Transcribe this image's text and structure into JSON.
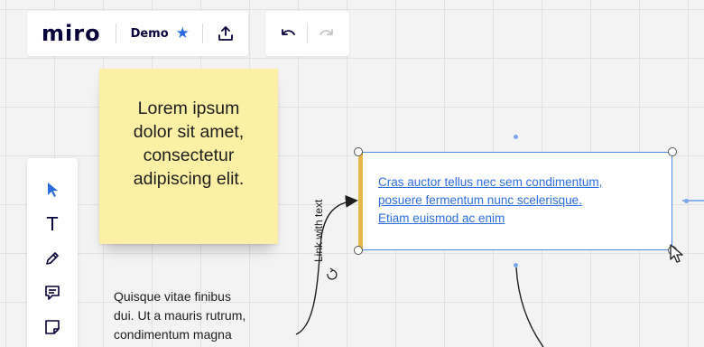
{
  "app": {
    "logo": "miro",
    "board_name": "Demo"
  },
  "topbar": {
    "star_icon": "star-icon",
    "share_icon": "upload-icon",
    "undo_icon": "undo-icon",
    "redo_icon": "redo-icon"
  },
  "left_toolbar": {
    "tools": [
      {
        "name": "select",
        "icon": "cursor-arrow-icon",
        "active": true
      },
      {
        "name": "text",
        "icon": "text-icon",
        "glyph": "T"
      },
      {
        "name": "pen",
        "icon": "pen-icon"
      },
      {
        "name": "comment",
        "icon": "comment-icon"
      },
      {
        "name": "sticky-note",
        "icon": "sticky-note-icon"
      }
    ]
  },
  "canvas": {
    "sticky_note": {
      "lines": [
        "Lorem ipsum",
        "dolor sit amet,",
        "consectetur",
        "adipiscing elit."
      ],
      "color": "#fcf0a4"
    },
    "free_text": {
      "lines": [
        "Quisque vitae finibus",
        "dui. Ut a mauris rutrum,",
        "condimentum magna"
      ]
    },
    "card": {
      "lines": [
        "Cras auctor tellus nec sem condimentum,",
        "posuere fermentum nunc scelerisque.",
        "Etiam euismod ac enim"
      ],
      "accent_color": "#e6b84a",
      "selection_color": "#4b8be6"
    },
    "connector": {
      "label": "Link with text"
    }
  }
}
